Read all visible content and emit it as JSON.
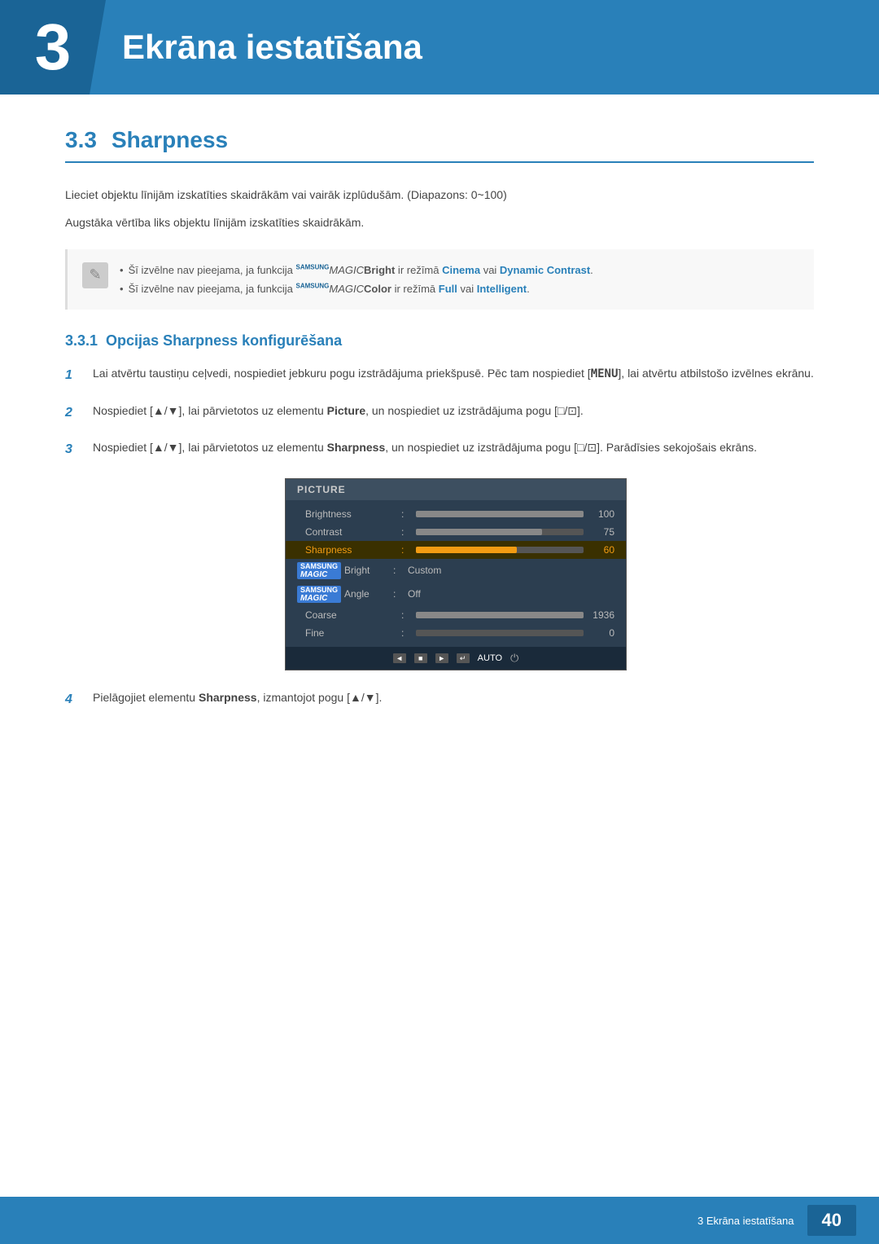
{
  "header": {
    "number": "3",
    "title": "Ekrāna iestatīšana"
  },
  "section": {
    "number": "3.3",
    "name": "Sharpness",
    "description1": "Lieciet objektu līnijām izskatīties skaidrākām vai vairāk izplūdušām. (Diapazons: 0~100)",
    "description2": "Augstāka vērtība liks objektu līnijām izskatīties skaidrākām.",
    "note1": "Šī izvēlne nav pieejama, ja funkcija ",
    "note1_brand": "SAMSUNG",
    "note1_magic": "MAGIC",
    "note1_feature": "Bright",
    "note1_mid": " ir režīmā ",
    "note1_val1": "Cinema",
    "note1_val2": " vai ",
    "note1_val3": "Dynamic Contrast",
    "note1_end": ".",
    "note2": "Šī izvēlne nav pieejama, ja funkcija ",
    "note2_brand": "SAMSUNG",
    "note2_magic": "MAGIC",
    "note2_feature": "Color",
    "note2_mid": " ir režīmā ",
    "note2_val1": "Full",
    "note2_val2": " vai ",
    "note2_val3": "Intelligent",
    "note2_end": ".",
    "subsection": {
      "number": "3.3.1",
      "name": "Opcijas Sharpness konfigurēšana"
    },
    "steps": [
      {
        "num": "1",
        "text": "Lai atvērtu taustiņu ceļvedi, nospiediet jebkuru pogu izstrādājuma priekšpusē. Pēc tam nospiediet [MENU], lai atvērtu atbilstošo izvēlnes ekrānu."
      },
      {
        "num": "2",
        "text": "Nospiediet [▲/▼], lai pārvietotos uz elementu Picture, un nospiediet uz izstrādājuma pogu [□/□]."
      },
      {
        "num": "3",
        "text": "Nospiediet [▲/▼], lai pārvietotos uz elementu Sharpness, un nospiediet uz izstrādājuma pogu [□/□]. Parādīsies sekojošais ekrāns."
      },
      {
        "num": "4",
        "text": "Pielāgojiet elementu Sharpness, izmantojot pogu [▲/▼]."
      }
    ],
    "picture_menu": {
      "header": "PICTURE",
      "items": [
        {
          "label": "Brightness",
          "type": "bar",
          "fill": 100,
          "value": "100",
          "active": false
        },
        {
          "label": "Contrast",
          "type": "bar",
          "fill": 75,
          "value": "75",
          "active": false
        },
        {
          "label": "Sharpness",
          "type": "bar",
          "fill": 60,
          "value": "60",
          "active": true
        },
        {
          "label": "SAMSUNG MAGIC Bright",
          "type": "text",
          "textValue": "Custom",
          "active": false
        },
        {
          "label": "SAMSUNG MAGIC Angle",
          "type": "text",
          "textValue": "Off",
          "active": false
        },
        {
          "label": "Coarse",
          "type": "bar",
          "fill": 100,
          "value": "1936",
          "active": false
        },
        {
          "label": "Fine",
          "type": "bar",
          "fill": 0,
          "value": "0",
          "active": false
        }
      ]
    }
  },
  "footer": {
    "text": "3 Ekrāna iestatīšana",
    "page": "40"
  }
}
